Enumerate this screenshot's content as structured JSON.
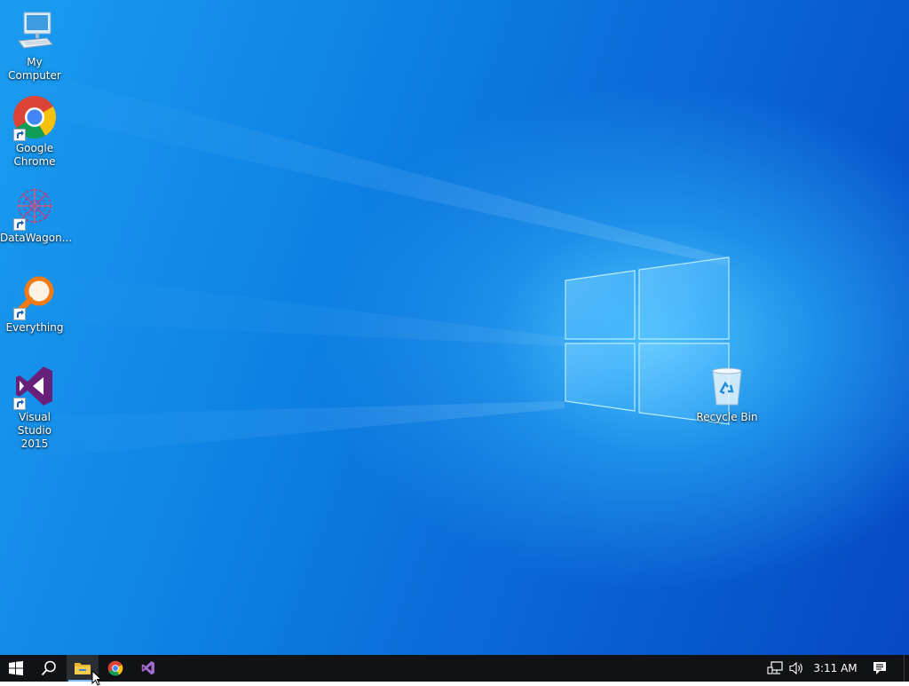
{
  "desktop": {
    "icons": [
      {
        "label": "My Computer",
        "icon": "computer-icon"
      },
      {
        "label": "Google Chrome",
        "icon": "chrome-icon",
        "shortcut": true
      },
      {
        "label": "DataWagon...",
        "icon": "datawagon-icon",
        "shortcut": true
      },
      {
        "label": "Everything",
        "icon": "everything-search-icon",
        "shortcut": true
      },
      {
        "label": "Visual Studio 2015",
        "icon": "visual-studio-icon",
        "shortcut": true
      },
      {
        "label": "Recycle Bin",
        "icon": "recycle-bin-icon"
      }
    ]
  },
  "taskbar": {
    "buttons": [
      {
        "name": "start",
        "icon": "windows-logo-icon"
      },
      {
        "name": "search",
        "icon": "search-icon"
      },
      {
        "name": "file-explorer",
        "icon": "folder-icon",
        "active": true
      },
      {
        "name": "chrome",
        "icon": "chrome-icon"
      },
      {
        "name": "visual-studio",
        "icon": "visual-studio-icon"
      }
    ],
    "tray": {
      "network_icon": "network-icon",
      "volume_icon": "volume-icon",
      "clock": "3:11 AM",
      "notifications_icon": "action-center-icon"
    }
  },
  "colors": {
    "taskbar": "#101215",
    "desktop_accent": "#0a78e0",
    "chrome_red": "#db4437",
    "chrome_yellow": "#f4c20d",
    "chrome_green": "#0f9d58",
    "chrome_blue": "#4285f4",
    "vs_purple": "#68217a",
    "everything_orange": "#f07a14"
  }
}
